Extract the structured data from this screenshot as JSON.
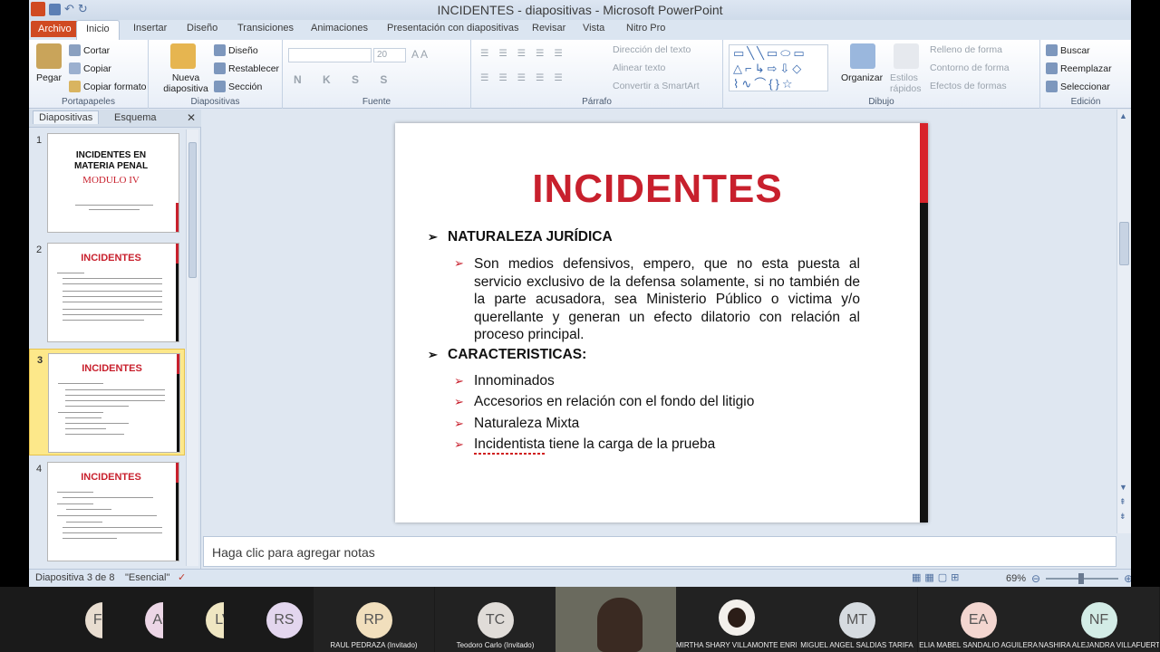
{
  "app": {
    "window_title": "INCIDENTES - diapositivas - Microsoft PowerPoint"
  },
  "tabs": [
    "Archivo",
    "Inicio",
    "Insertar",
    "Diseño",
    "Transiciones",
    "Animaciones",
    "Presentación con diapositivas",
    "Revisar",
    "Vista",
    "Nitro Pro"
  ],
  "ribbon": {
    "portapapeles": {
      "label": "Portapapeles",
      "paste": "Pegar",
      "cut": "Cortar",
      "copy": "Copiar",
      "format": "Copiar formato"
    },
    "diapositivas": {
      "label": "Diapositivas",
      "new": "Nueva diapositiva",
      "layout": "Diseño",
      "reset": "Restablecer",
      "section": "Sección"
    },
    "fuente": {
      "label": "Fuente",
      "size": "20"
    },
    "parrafo": {
      "label": "Párrafo",
      "dir": "Dirección del texto",
      "align": "Alinear texto",
      "smartart": "Convertir a SmartArt"
    },
    "dibujo": {
      "label": "Dibujo",
      "organize": "Organizar",
      "styles": "Estilos rápidos",
      "fill": "Relleno de forma",
      "outline": "Contorno de forma",
      "effects": "Efectos de formas"
    },
    "edicion": {
      "label": "Edición",
      "find": "Buscar",
      "replace": "Reemplazar",
      "select": "Seleccionar"
    }
  },
  "left_pane": {
    "tab_slides": "Diapositivas",
    "tab_outline": "Esquema",
    "thumbs": [
      {
        "num": "1",
        "title1": "INCIDENTES EN",
        "title2": "MATERIA PENAL",
        "sub": "MODULO IV"
      },
      {
        "num": "2",
        "title": "INCIDENTES"
      },
      {
        "num": "3",
        "title": "INCIDENTES"
      },
      {
        "num": "4",
        "title": "INCIDENTES"
      }
    ]
  },
  "slide": {
    "title": "INCIDENTES",
    "h1": "NATURALEZA JURÍDICA",
    "paragraph": "Son medios defensivos, empero, que no esta puesta al servicio exclusivo de la defensa solamente, si no también de la parte acusadora, sea Ministerio Público o victima y/o querellante y generan un efecto dilatorio con relación al proceso principal.",
    "h2": "CARACTERISTICAS:",
    "items": [
      "Innominados",
      "Accesorios  en relación con el fondo del litigio",
      "Naturaleza  Mixta",
      "Incidentista  tiene la carga de la prueba"
    ]
  },
  "notes_placeholder": "Haga clic para agregar notas",
  "status": {
    "slide": "Diapositiva 3 de 8",
    "theme": "\"Esencial\"",
    "zoom": "69%"
  },
  "participants": [
    {
      "initials": "FC",
      "name": "",
      "color": "#e8ddd0"
    },
    {
      "initials": "AC",
      "name": "",
      "color": "#ecd6e6"
    },
    {
      "initials": "LV",
      "name": "",
      "color": "#efe6c2"
    },
    {
      "initials": "RS",
      "name": "",
      "color": "#e3d6ee"
    },
    {
      "initials": "RP",
      "name": "RAUL PEDRAZA (Invitado)",
      "color": "#f1dfbd"
    },
    {
      "initials": "TC",
      "name": "Teodoro Carlo (Invitado)",
      "color": "#e0dcd8"
    },
    {
      "initials": "",
      "name": "",
      "color": "#333"
    },
    {
      "initials": "",
      "name": "MIRTHA  SHARY  VILLAMONTE ENRI...",
      "color": "#cfc5bd"
    },
    {
      "initials": "MT",
      "name": "MIGUEL ANGEL SALDIAS TARIFA",
      "color": "#d6dbe0"
    },
    {
      "initials": "EA",
      "name": "ELIA MABEL SANDALIO AGUILERA",
      "color": "#f3d6d0"
    },
    {
      "initials": "NF",
      "name": "NASHIRA  ALEJANDRA  VILLAFUERT...",
      "color": "#d3ece6"
    }
  ]
}
